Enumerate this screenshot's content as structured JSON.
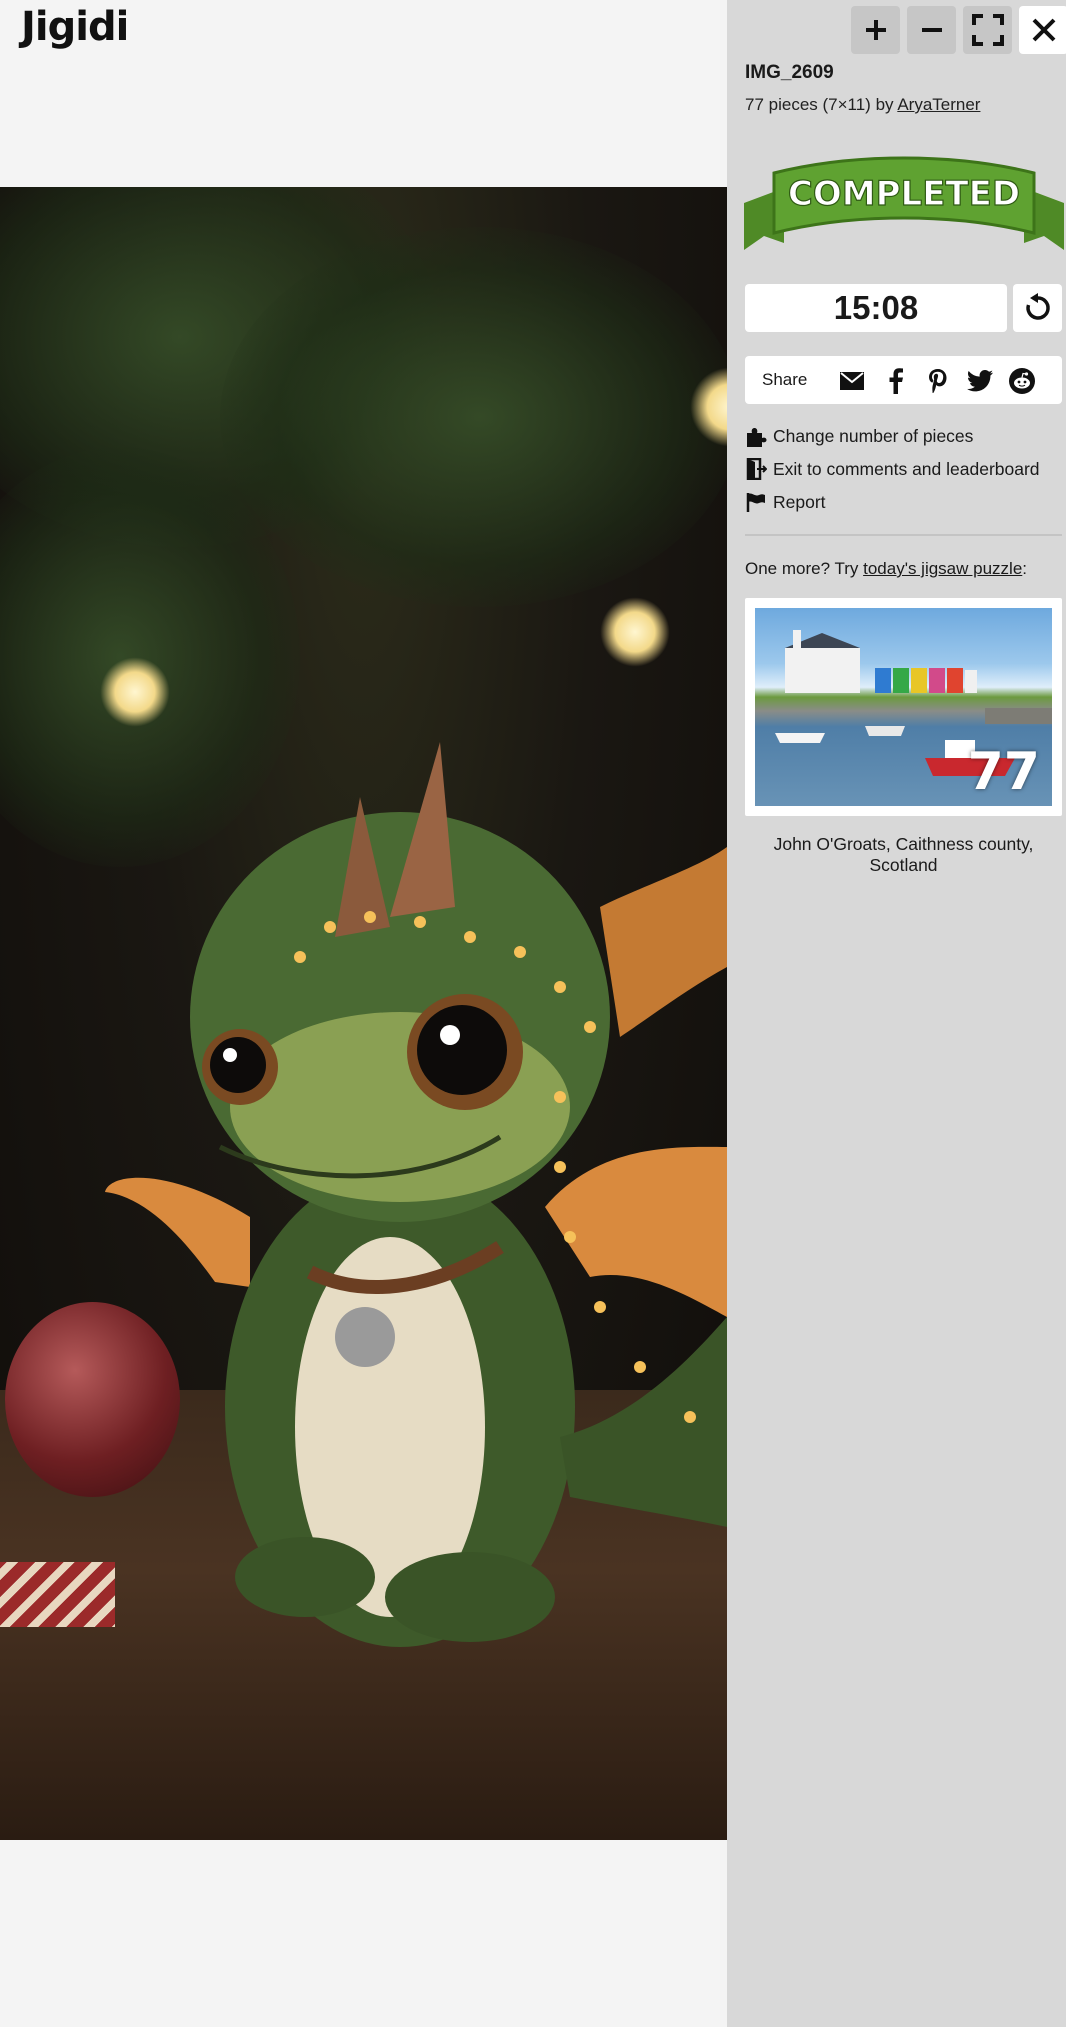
{
  "app": {
    "logo": "Jigidi"
  },
  "toolbar": {
    "zoom_in": "plus-icon",
    "zoom_out": "minus-icon",
    "fullscreen": "fullscreen-icon",
    "close": "close-icon"
  },
  "puzzle": {
    "title": "IMG_2609",
    "meta_prefix": "77 pieces (7×11) by ",
    "author": "AryaTerner",
    "status_banner": "COMPLETED",
    "timer": "15:08"
  },
  "share": {
    "label": "Share",
    "icons": [
      "email-icon",
      "facebook-icon",
      "pinterest-icon",
      "twitter-icon",
      "reddit-icon"
    ]
  },
  "menu": [
    {
      "icon": "puzzle-piece-icon",
      "label": "Change number of pieces"
    },
    {
      "icon": "exit-door-icon",
      "label": "Exit to comments and leaderboard"
    },
    {
      "icon": "flag-icon",
      "label": "Report"
    }
  ],
  "suggestion": {
    "prefix": "One more? Try ",
    "link": "today's jigsaw puzzle",
    "suffix": ":",
    "pieces": "77",
    "caption": "John O'Groats, Caithness county, Scotland"
  },
  "colors": {
    "sidebar_bg": "#d8d8d8",
    "page_bg": "#f4f4f4",
    "banner_green": "#5a9a2e"
  }
}
